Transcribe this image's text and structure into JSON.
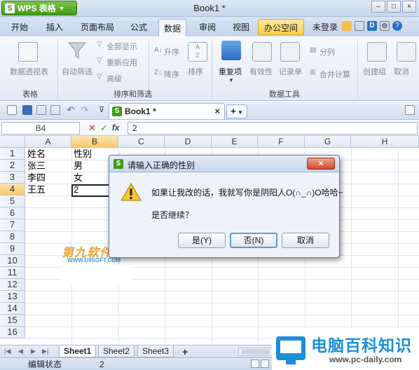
{
  "app": {
    "name": "WPS 表格",
    "logo_letter": "S",
    "document_title": "Book1 *"
  },
  "window_controls": [
    "–",
    "□",
    "×"
  ],
  "tabs": [
    {
      "label": "开始"
    },
    {
      "label": "插入"
    },
    {
      "label": "页面布局"
    },
    {
      "label": "公式"
    },
    {
      "label": "数据",
      "active": true
    },
    {
      "label": "审阅"
    },
    {
      "label": "视图"
    },
    {
      "label": "办公空间"
    }
  ],
  "account": {
    "login_label": "未登录"
  },
  "ribbon": {
    "pivot_label": "数据透视表",
    "autofilter_label": "自动筛选",
    "show_all_label": "全部显示",
    "reapply_label": "重新应用",
    "advanced_label": "高级",
    "asc_label": "升序",
    "desc_label": "降序",
    "sort_label": "排序",
    "duplicates_label": "重复项",
    "validity_label": "有效性",
    "record_label": "记录单",
    "split_label": "分列",
    "merge_calc_label": "合并计算",
    "group_create_label": "创建组",
    "ungroup_label": "取消",
    "group_table": "表格",
    "group_sortfilter": "排序和筛选",
    "group_datatools": "数据工具"
  },
  "doc_tab": {
    "name": "Book1 *",
    "close": "×",
    "new_tab": "+"
  },
  "formula_bar": {
    "cell_ref": "B4",
    "cancel": "✕",
    "confirm": "✓",
    "fx": "fx",
    "value": "2"
  },
  "grid": {
    "columns": [
      "A",
      "B",
      "C",
      "D",
      "E",
      "F",
      "G",
      "H"
    ],
    "rows": [
      "1",
      "2",
      "3",
      "4",
      "5",
      "6",
      "7",
      "8",
      "9",
      "10",
      "11",
      "12",
      "13",
      "14",
      "15",
      "16"
    ],
    "cells": {
      "A1": "姓名",
      "B1": "性别",
      "A2": "张三",
      "B2": "男",
      "A3": "李四",
      "B3": "女",
      "A4": "王五",
      "B4": "2"
    }
  },
  "watermark": {
    "text": "第九软件网",
    "url": "WWW.D9SOFT.COM"
  },
  "sheets": [
    "Sheet1",
    "Sheet2",
    "Sheet3"
  ],
  "add_sheet": "+",
  "status": {
    "mode": "编辑状态",
    "value": "2"
  },
  "brand": {
    "name": "电脑百科知识",
    "url": "www.pc-daily.com"
  },
  "dialog": {
    "title": "请输入正确的性别",
    "close_label": "×",
    "message": "如果让我改的话，我就写你是阴阳人O(∩_∩)O哈哈~",
    "question": "是否继续？",
    "yes_label": "是(Y)",
    "no_label": "否(N)",
    "cancel_label": "取消"
  },
  "colors": {
    "accent_blue": "#1c8fd8",
    "wps_green": "#3f9a1c",
    "dialog_close_red": "#d04a30",
    "selection_gold": "#f7c86a"
  }
}
